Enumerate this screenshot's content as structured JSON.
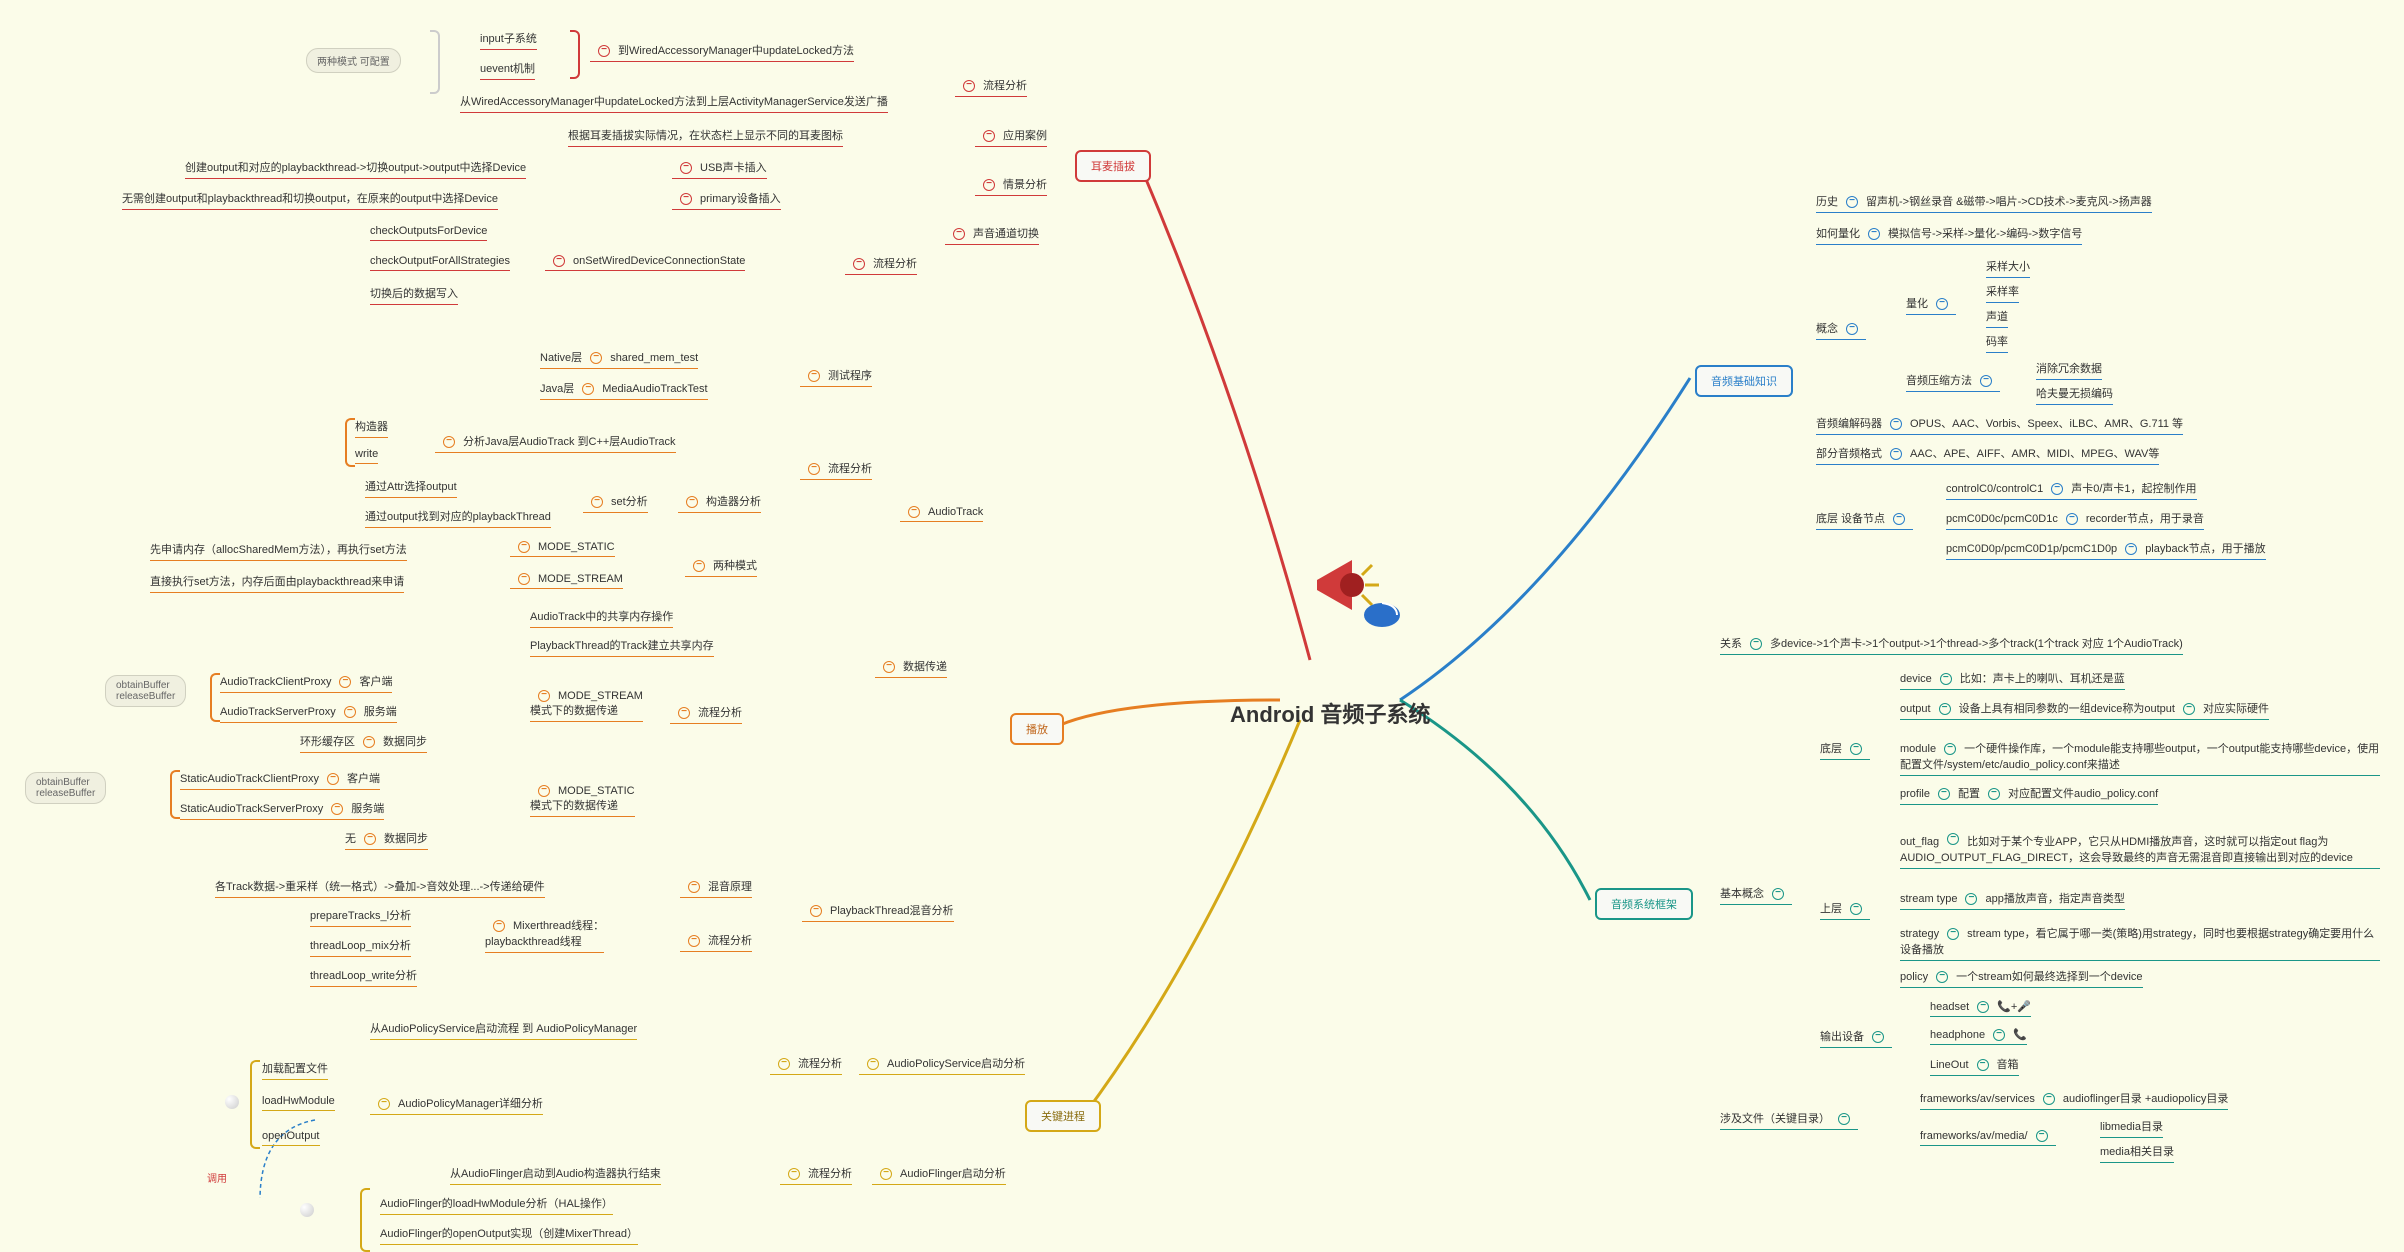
{
  "center": "Android 音频子系统",
  "hubs": {
    "basics": "音频基础知识",
    "framework": "音频系统框架",
    "process": "关键进程",
    "play": "播放",
    "headset": "耳麦插拔"
  },
  "basics": {
    "history": {
      "k": "历史",
      "v": "留声机->钢丝录音 &磁带->唱片->CD技术->麦克风->扬声器"
    },
    "quant": {
      "k": "如何量化",
      "v": "模拟信号->采样->量化->编码->数字信号"
    },
    "concept": "概念",
    "quantization": "量化",
    "q1": "采样大小",
    "q2": "采样率",
    "q3": "声道",
    "q4": "码率",
    "compress": {
      "k": "音频压缩方法",
      "v1": "消除冗余数据",
      "v2": "哈夫曼无损编码"
    },
    "codec": {
      "k": "音频编解码器",
      "v": "OPUS、AAC、Vorbis、Speex、iLBC、AMR、G.711 等"
    },
    "format": {
      "k": "部分音频格式",
      "v": "AAC、APE、AIFF、AMR、MIDI、MPEG、WAV等"
    },
    "lowdev": {
      "k": "底层 设备节点",
      "c1k": "controlC0/controlC1",
      "c1v": "声卡0/声卡1，起控制作用",
      "c2k": "pcmC0D0c/pcmC0D1c",
      "c2v": "recorder节点，用于录音",
      "c3k": "pcmC0D0p/pcmC0D1p/pcmC1D0p",
      "c3v": "playback节点，用于播放"
    }
  },
  "framework": {
    "relation": {
      "k": "关系",
      "v": "多device->1个声卡->1个output->1个thread->多个track(1个track 对应 1个AudioTrack)"
    },
    "basic": "基本概念",
    "low": "底层",
    "high": "上层",
    "device": {
      "k": "device",
      "v": "比如：声卡上的喇叭、耳机还是蓝"
    },
    "output": {
      "k": "output",
      "v": "设备上具有相同参数的一组device称为output",
      "v2": "对应实际硬件"
    },
    "module": {
      "k": "module",
      "v": "一个硬件操作库，一个module能支持哪些output，一个output能支持哪些device，使用配置文件/system/etc/audio_policy.conf来描述"
    },
    "profile": {
      "k": "profile",
      "v": "配置",
      "v2": "对应配置文件audio_policy.conf"
    },
    "outflag": {
      "k": "out_flag",
      "v": "比如对于某个专业APP，它只从HDMI播放声音，这时就可以指定out flag为AUDIO_OUTPUT_FLAG_DIRECT，这会导致最终的声音无需混音即直接输出到对应的device"
    },
    "stype": {
      "k": "stream type",
      "v": "app播放声音，指定声音类型"
    },
    "strategy": {
      "k": "strategy",
      "v": "stream type，看它属于哪一类(策略)用strategy，同时也要根据strategy确定要用什么设备播放"
    },
    "policy": {
      "k": "policy",
      "v": "一个stream如何最终选择到一个device"
    },
    "outdev": {
      "k": "输出设备",
      "h1": "headset",
      "h1i": "📞+🎤",
      "h2": "headphone",
      "h2i": "📞",
      "h3": "LineOut",
      "h3v": "音箱"
    },
    "files": {
      "k": "涉及文件（关键目录）",
      "f1": "frameworks/av/services",
      "f1v": "audioflinger目录 +audiopolicy目录",
      "f2": "frameworks/av/media/",
      "f2v1": "libmedia目录",
      "f2v2": "media相关目录"
    }
  },
  "process": {
    "aps": {
      "k": "AudioPolicyService启动分析",
      "flow": "流程分析",
      "s1": "从AudioPolicyService启动流程 到 AudioPolicyManager",
      "s2": "加载配置文件",
      "detail": "AudioPolicyManager详细分析",
      "s3": "loadHwModule",
      "s4": "openOutput"
    },
    "af": {
      "k": "AudioFlinger启动分析",
      "flow": "流程分析",
      "s1": "从AudioFlinger启动到Audio构造器执行结束",
      "s2": "AudioFlinger的loadHwModule分析（HAL操作）",
      "s3": "AudioFlinger的openOutput实现（创建MixerThread）"
    },
    "call": "调用"
  },
  "play": {
    "at": {
      "k": "AudioTrack",
      "test": "测试程序",
      "native": "Native层",
      "nv": "shared_mem_test",
      "java": "Java层",
      "jv": "MediaAudioTrackTest",
      "flow": "流程分析",
      "fv": "分析Java层AudioTrack 到C++层AudioTrack",
      "ctor": "构造器",
      "write": "write",
      "cons": "构造器分析",
      "setk": "set分析",
      "set1": "通过Attr选择output",
      "set2": "通过output找到对应的playbackThread",
      "mode": "两种模式",
      "ms": "MODE_STATIC",
      "msv": "先申请内存（allocSharedMem方法），再执行set方法",
      "mst": "MODE_STREAM",
      "mstv": "直接执行set方法，内存后面由playbackthread来申请"
    },
    "dt": {
      "k": "数据传递",
      "s1": "AudioTrack中的共享内存操作",
      "s2": "PlaybackThread的Track建立共享内存",
      "stream": {
        "k": "MODE_STREAM\n模式下的数据传递",
        "flow": "流程分析",
        "c": "客户端",
        "cv": "AudioTrackClientProxy",
        "s": "服务端",
        "sv": "AudioTrackServerProxy",
        "sync": "数据同步",
        "syncv": "环形缓存区"
      },
      "static": {
        "k": "MODE_STATIC\n模式下的数据传递",
        "c": "客户端",
        "cv": "StaticAudioTrackClientProxy",
        "s": "服务端",
        "sv": "StaticAudioTrackServerProxy",
        "sync": "数据同步",
        "syncv": "无"
      }
    },
    "pb": {
      "k": "PlaybackThread混音分析",
      "mix": {
        "k": "混音原理",
        "v": "各Track数据->重采样（统一格式）->叠加->音效处理...->传递给硬件"
      },
      "flow": "流程分析",
      "mixer": "Mixerthread线程：\nplaybackthread线程",
      "s1": "prepareTracks_l分析",
      "s2": "threadLoop_mix分析",
      "s3": "threadLoop_write分析"
    },
    "ob": "obtainBuffer\nreleaseBuffer",
    "ob2": "obtainBuffer\nreleaseBuffer"
  },
  "headset": {
    "flow": "流程分析",
    "mode": "两种模式 可配置",
    "input": "input子系统",
    "uevent": "uevent机制",
    "to": "到WiredAccessoryManager中updateLocked方法",
    "f2": "从WiredAccessoryManager中updateLocked方法到上层ActivityManagerService发送广播",
    "case": {
      "k": "应用案例",
      "v": "根据耳麦插拔实际情况，在状态栏上显示不同的耳麦图标"
    },
    "scene": {
      "k": "情景分析",
      "usb": "USB声卡插入",
      "usbv": "创建output和对应的playbackthread->切换output->output中选择Device",
      "pri": "primary设备插入",
      "priv": "无需创建output和playbackthread和切换output，在原来的output中选择Device"
    },
    "swch": {
      "k": "声音通道切换",
      "flow": "流程分析",
      "state": "onSetWiredDeviceConnectionState",
      "s1": "checkOutputsForDevice",
      "s2": "checkOutputForAllStrategies",
      "s3": "切换后的数据写入"
    }
  }
}
